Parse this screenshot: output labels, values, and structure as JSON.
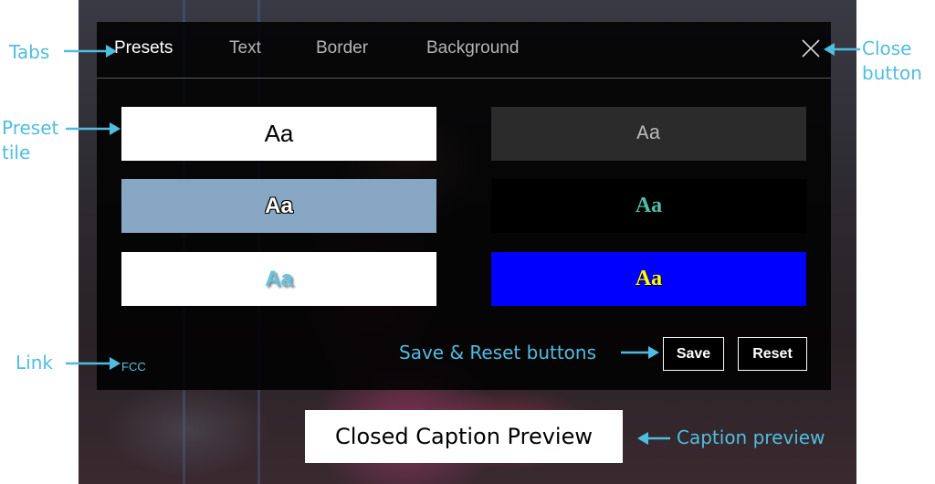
{
  "panel": {
    "tabs": [
      {
        "label": "Presets",
        "active": true
      },
      {
        "label": "Text",
        "active": false
      },
      {
        "label": "Border",
        "active": false
      },
      {
        "label": "Background",
        "active": false
      }
    ],
    "close_icon": "close-x-icon",
    "presets": [
      {
        "sample": "Aa",
        "background": "#ffffff",
        "color": "#000000"
      },
      {
        "sample": "Aa",
        "background": "#2b2b2b",
        "color": "#b8b8b8"
      },
      {
        "sample": "Aa",
        "background": "#87a7c5",
        "color": "#ffffff"
      },
      {
        "sample": "Aa",
        "background": "#000000",
        "color": "#4fbfa8"
      },
      {
        "sample": "Aa",
        "background": "#ffffff",
        "color": "#5fc4e6"
      },
      {
        "sample": "Aa",
        "background": "#0000ff",
        "color": "#ffff00"
      }
    ],
    "link_label": "FCC",
    "save_label": "Save",
    "reset_label": "Reset"
  },
  "caption_preview": "Closed Caption Preview",
  "annotations": {
    "tabs": "Tabs",
    "close_line1": "Close",
    "close_line2": "button",
    "preset_line1": "Preset",
    "preset_line2": "tile",
    "link": "Link",
    "save_reset": "Save & Reset buttons",
    "caption_preview": "Caption preview"
  },
  "colors": {
    "annotation": "#4fbde0",
    "link": "#55c2e2"
  }
}
